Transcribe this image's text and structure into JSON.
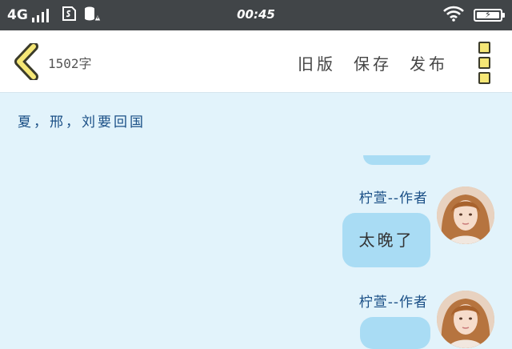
{
  "status_bar": {
    "network": "4G",
    "time": "00:45",
    "sim_icon": "sim-card-icon",
    "storage_icon": "storage-warning-icon",
    "wifi_icon": "wifi-icon",
    "battery_icon": "battery-charging-icon",
    "battery_level": 1.0,
    "signal_bars": 4
  },
  "toolbar": {
    "back_icon": "chevron-left-icon",
    "word_count": "1502字",
    "old_version": "旧版",
    "save": "保存",
    "publish": "发布",
    "more_icon": "more-vertical-icon"
  },
  "chat": {
    "title": "夏，邢，刘要回国",
    "messages": [
      {
        "author": "柠萱--作者",
        "text": "太晚了",
        "avatar_icon": "avatar-image"
      },
      {
        "author": "柠萱--作者",
        "text": "",
        "avatar_icon": "avatar-image"
      }
    ]
  },
  "colors": {
    "status_bar_bg": "#414548",
    "chat_bg": "#e2f3fb",
    "bubble": "#a9dcf4",
    "author_text": "#1a4f86",
    "accent_yellow": "#f5e776"
  }
}
